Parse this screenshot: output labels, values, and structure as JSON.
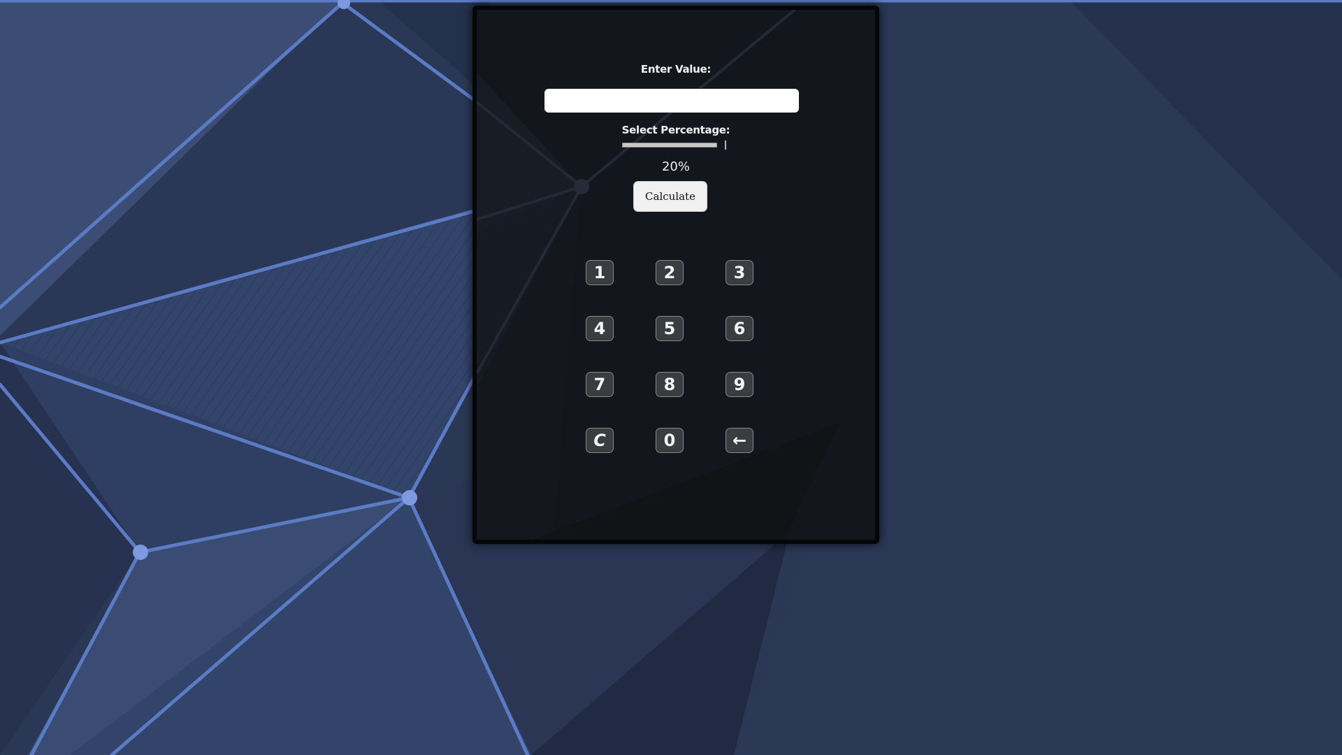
{
  "form": {
    "value_label": "Enter Value:",
    "value_input": "",
    "percentage_label": "Select Percentage:",
    "percentage_value": 20,
    "percentage_display": "20%",
    "calculate_label": "Calculate"
  },
  "keypad": {
    "keys": [
      "1",
      "2",
      "3",
      "4",
      "5",
      "6",
      "7",
      "8",
      "9",
      "C",
      "0",
      "←"
    ]
  },
  "colors": {
    "background": "#2b3855",
    "network_line": "#5b7cc4",
    "card": "#13161c",
    "key": "#3a3c40"
  }
}
